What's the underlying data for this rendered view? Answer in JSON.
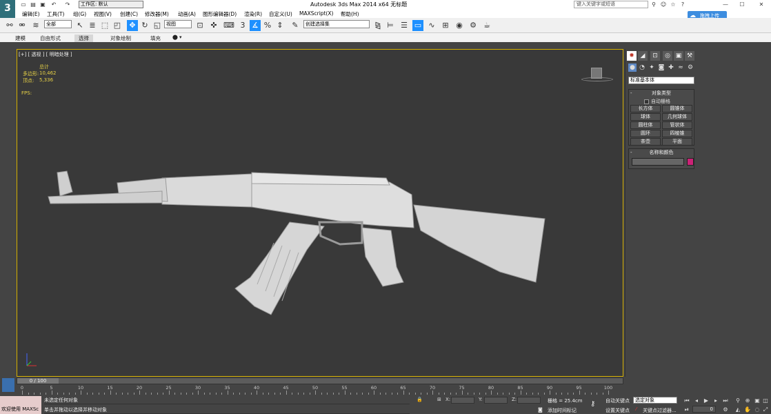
{
  "window": {
    "title": "Autodesk 3ds Max  2014 x64     无标题",
    "workspace_label": "工作区: 默认",
    "search_placeholder": "键入关键字或短语",
    "upload_label": "拖拽上传"
  },
  "menu": [
    "编辑(E)",
    "工具(T)",
    "组(G)",
    "视图(V)",
    "创建(C)",
    "修改器(M)",
    "动画(A)",
    "图形编辑器(D)",
    "渲染(R)",
    "自定义(U)",
    "MAXScript(X)",
    "帮助(H)"
  ],
  "toolbar": {
    "filter_dropdown": "全部",
    "refcoord_dropdown": "视图",
    "selection_set_dropdown": "创建选择集"
  },
  "ribbon": {
    "tabs": [
      "建模",
      "自由形式",
      "选择",
      "对象绘制",
      "填充"
    ],
    "selected": "选择"
  },
  "viewport": {
    "label": "[+] [ 透视 ] [ 明暗处理 ]",
    "stats": {
      "total_label": "总计",
      "polys_label": "多边形:",
      "polys_value": "10,462",
      "verts_label": "顶点:",
      "verts_value": "5,336",
      "fps_label": "FPS:"
    }
  },
  "command_panel": {
    "category_dropdown": "标准基本体",
    "object_type_title": "对象类型",
    "autogrid_label": "自动栅格",
    "objects": [
      "长方体",
      "圆锥体",
      "球体",
      "几何球体",
      "圆柱体",
      "管状体",
      "圆环",
      "四棱锥",
      "茶壶",
      "平面"
    ],
    "name_color_title": "名称和颜色",
    "color": "#cc2277"
  },
  "timeline": {
    "thumb_label": "0 / 100",
    "ticks": [
      "0",
      "5",
      "10",
      "15",
      "20",
      "25",
      "30",
      "35",
      "40",
      "45",
      "50",
      "55",
      "60",
      "65",
      "70",
      "75",
      "80",
      "85",
      "90",
      "95",
      "100"
    ]
  },
  "status": {
    "maxscript_label": "欢迎使用 MAXSc",
    "line1": "未选定任何对象",
    "line2": "单击并拖动以选择并移动对象",
    "x_label": "X:",
    "y_label": "Y:",
    "z_label": "Z:",
    "grid_label": "栅格 = 25.4cm",
    "add_time_tag": "添加时间标记",
    "auto_key": "自动关键点",
    "set_key": "设置关键点",
    "selected_dropdown": "选定对象",
    "key_filters": "关键点过滤器...",
    "frame_value": "0"
  }
}
